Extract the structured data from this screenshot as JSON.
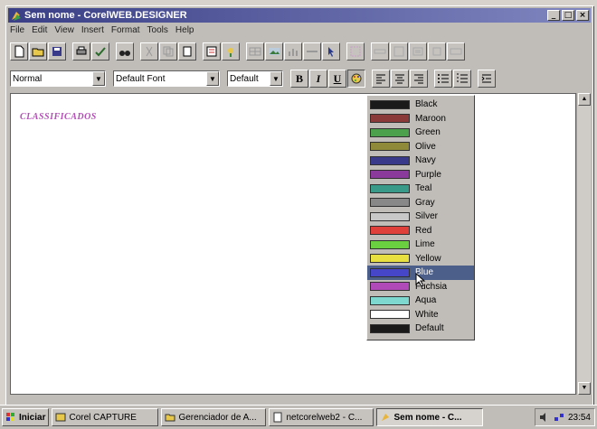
{
  "window": {
    "title": "Sem nome - CorelWEB.DESIGNER"
  },
  "menu": [
    "File",
    "Edit",
    "View",
    "Insert",
    "Format",
    "Tools",
    "Help"
  ],
  "format_bar": {
    "style": "Normal",
    "font": "Default Font",
    "size": "Default",
    "bold": "B",
    "italic": "I",
    "underline": "U"
  },
  "document": {
    "heading": "CLASSIFICADOS"
  },
  "color_menu": {
    "selected": "Blue",
    "items": [
      {
        "name": "Black",
        "color": "#1a1a1a"
      },
      {
        "name": "Maroon",
        "color": "#8b3a3a"
      },
      {
        "name": "Green",
        "color": "#4ca24c"
      },
      {
        "name": "Olive",
        "color": "#8f8a3a"
      },
      {
        "name": "Navy",
        "color": "#3a3a8a"
      },
      {
        "name": "Purple",
        "color": "#8a3a9a"
      },
      {
        "name": "Teal",
        "color": "#3a9a8a"
      },
      {
        "name": "Gray",
        "color": "#888888"
      },
      {
        "name": "Silver",
        "color": "#c8c8c8"
      },
      {
        "name": "Red",
        "color": "#e0403a"
      },
      {
        "name": "Lime",
        "color": "#6ad040"
      },
      {
        "name": "Yellow",
        "color": "#e8e040"
      },
      {
        "name": "Blue",
        "color": "#4646c8"
      },
      {
        "name": "Fuchsia",
        "color": "#b04ab8"
      },
      {
        "name": "Aqua",
        "color": "#7fd8d0"
      },
      {
        "name": "White",
        "color": "#ffffff"
      },
      {
        "name": "Default",
        "color": "#1a1a1a"
      }
    ]
  },
  "taskbar": {
    "start": "Iniciar",
    "tasks": [
      "Corel CAPTURE",
      "Gerenciador de A...",
      "netcorelweb2 - C...",
      "Sem nome - C..."
    ],
    "time": "23:54"
  }
}
